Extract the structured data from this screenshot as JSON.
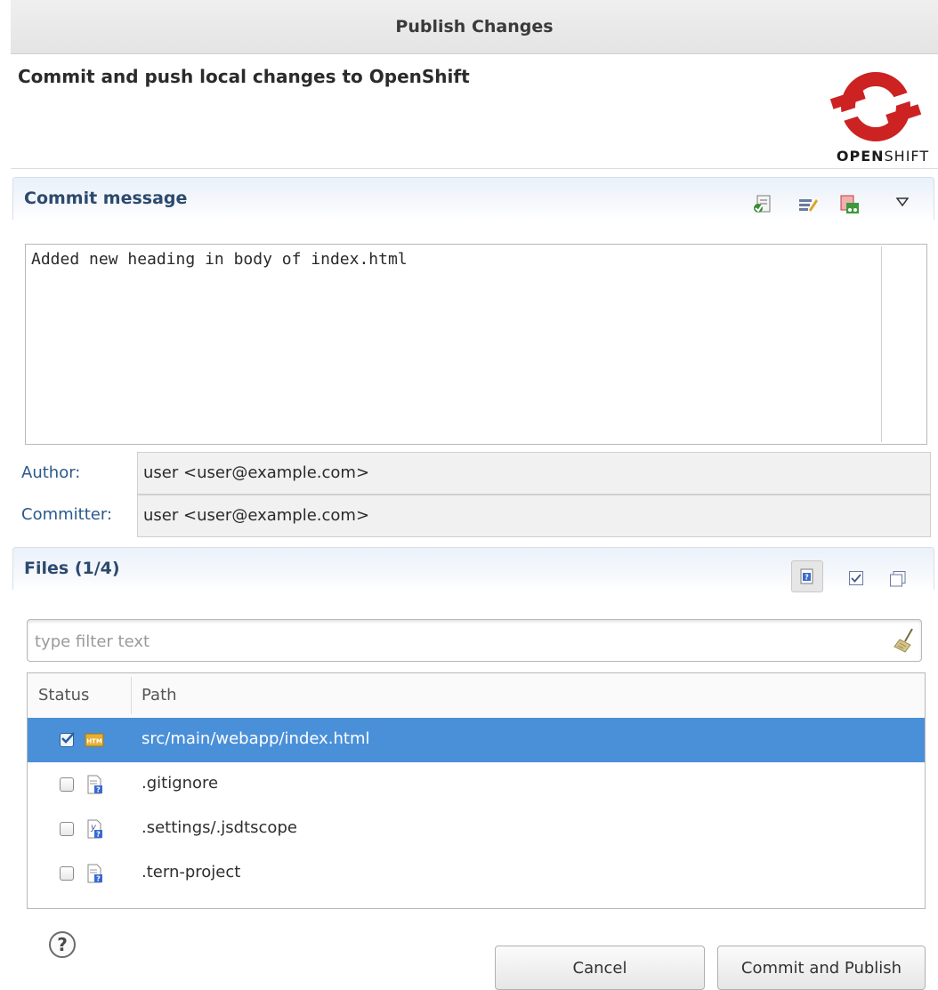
{
  "window": {
    "title": "Publish Changes"
  },
  "header": {
    "subtitle": "Commit and push local changes to OpenShift",
    "logo_text_bold": "OPEN",
    "logo_text_light": "SHIFT"
  },
  "commit": {
    "section_title": "Commit message",
    "message": "Added new heading in body of index.html",
    "author_label": "Author:",
    "author_value": "user <user@example.com>",
    "committer_label": "Committer:",
    "committer_value": "user <user@example.com>"
  },
  "files": {
    "section_title": "Files (1/4)",
    "filter_placeholder": "type filter text",
    "columns": [
      "Status",
      "Path"
    ],
    "rows": [
      {
        "path": "src/main/webapp/index.html",
        "checked": true,
        "selected": true,
        "icon": "html-file-icon"
      },
      {
        "path": ".gitignore",
        "checked": false,
        "selected": false,
        "icon": "untracked-file-icon"
      },
      {
        "path": ".settings/.jsdtscope",
        "checked": false,
        "selected": false,
        "icon": "untracked-settings-file-icon"
      },
      {
        "path": ".tern-project",
        "checked": false,
        "selected": false,
        "icon": "untracked-file-icon"
      }
    ]
  },
  "buttons": {
    "cancel": "Cancel",
    "commit_publish": "Commit and Publish"
  },
  "colors": {
    "accent": "#4a90d9",
    "brand": "#cc2222",
    "label": "#2a5a8a"
  }
}
